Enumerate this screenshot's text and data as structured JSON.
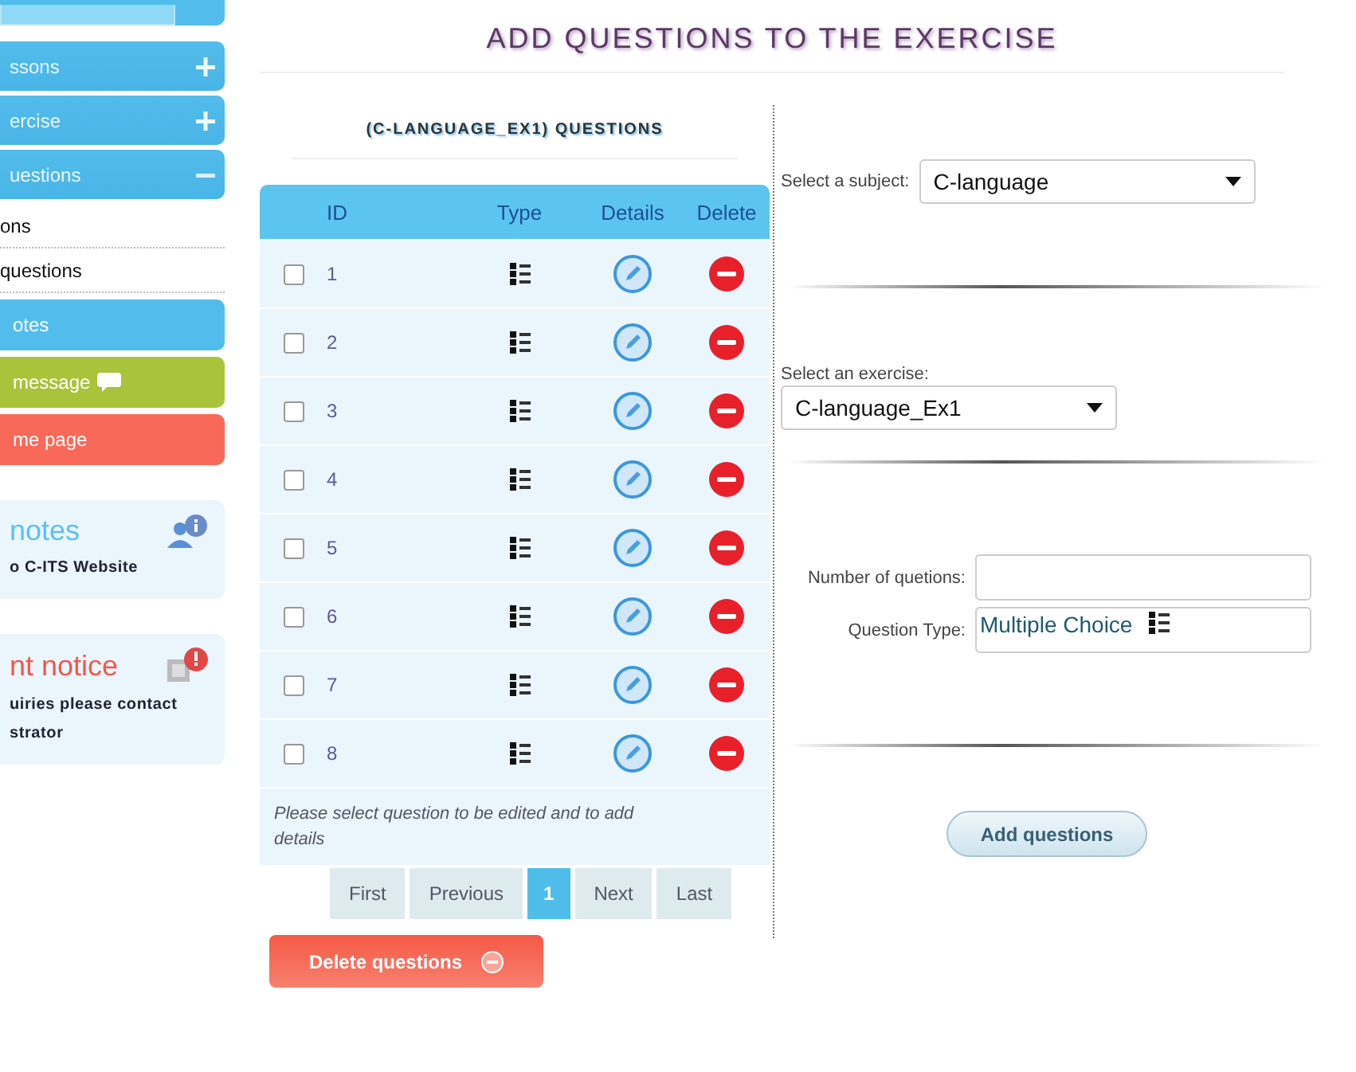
{
  "sidebar": {
    "sections": [
      {
        "label": "ssons",
        "expanded": false
      },
      {
        "label": "ercise",
        "expanded": false
      },
      {
        "label": "uestions",
        "expanded": true
      }
    ],
    "sub_items": [
      "ons",
      "questions"
    ],
    "buttons": [
      {
        "label": "otes",
        "color": "#52bdec"
      },
      {
        "label": "message",
        "color": "#a9c33a",
        "kind": "chat"
      },
      {
        "label": "me page",
        "color": "#f8695a"
      }
    ],
    "cards": [
      {
        "title": "notes",
        "text": "o C-ITS Website",
        "color": "#5bbff0",
        "kind": "info"
      },
      {
        "title": "nt notice",
        "text": "uiries please contact\nstrator",
        "color": "#f0574a",
        "kind": "alert"
      }
    ]
  },
  "page_title": "ADD QUESTIONS TO THE EXERCISE",
  "questions": {
    "title": "(C-LANGUAGE_EX1) QUESTIONS",
    "columns": [
      "ID",
      "Type",
      "Details",
      "Delete"
    ],
    "rows": [
      {
        "id": "1",
        "checked": false
      },
      {
        "id": "2",
        "checked": false
      },
      {
        "id": "3",
        "checked": false
      },
      {
        "id": "4",
        "checked": false
      },
      {
        "id": "5",
        "checked": false
      },
      {
        "id": "6",
        "checked": false
      },
      {
        "id": "7",
        "checked": false
      },
      {
        "id": "8",
        "checked": false
      }
    ],
    "hint": "Please select question to be edited and to add details",
    "pagination": [
      {
        "label": "First",
        "selected": false
      },
      {
        "label": "Previous",
        "selected": false
      },
      {
        "label": "1",
        "selected": true
      },
      {
        "label": "Next",
        "selected": false
      },
      {
        "label": "Last",
        "selected": false
      }
    ],
    "delete_button": "Delete questions"
  },
  "form": {
    "subject_label": "Select a subject:",
    "subject": "C-language",
    "exercise_label": "Select an exercise:",
    "exercise": "C-language_Ex1",
    "count_label": "Number of quetions:",
    "type_label": "Question Type:",
    "type_value": "Multiple Choice",
    "add_button": "Add questions"
  }
}
